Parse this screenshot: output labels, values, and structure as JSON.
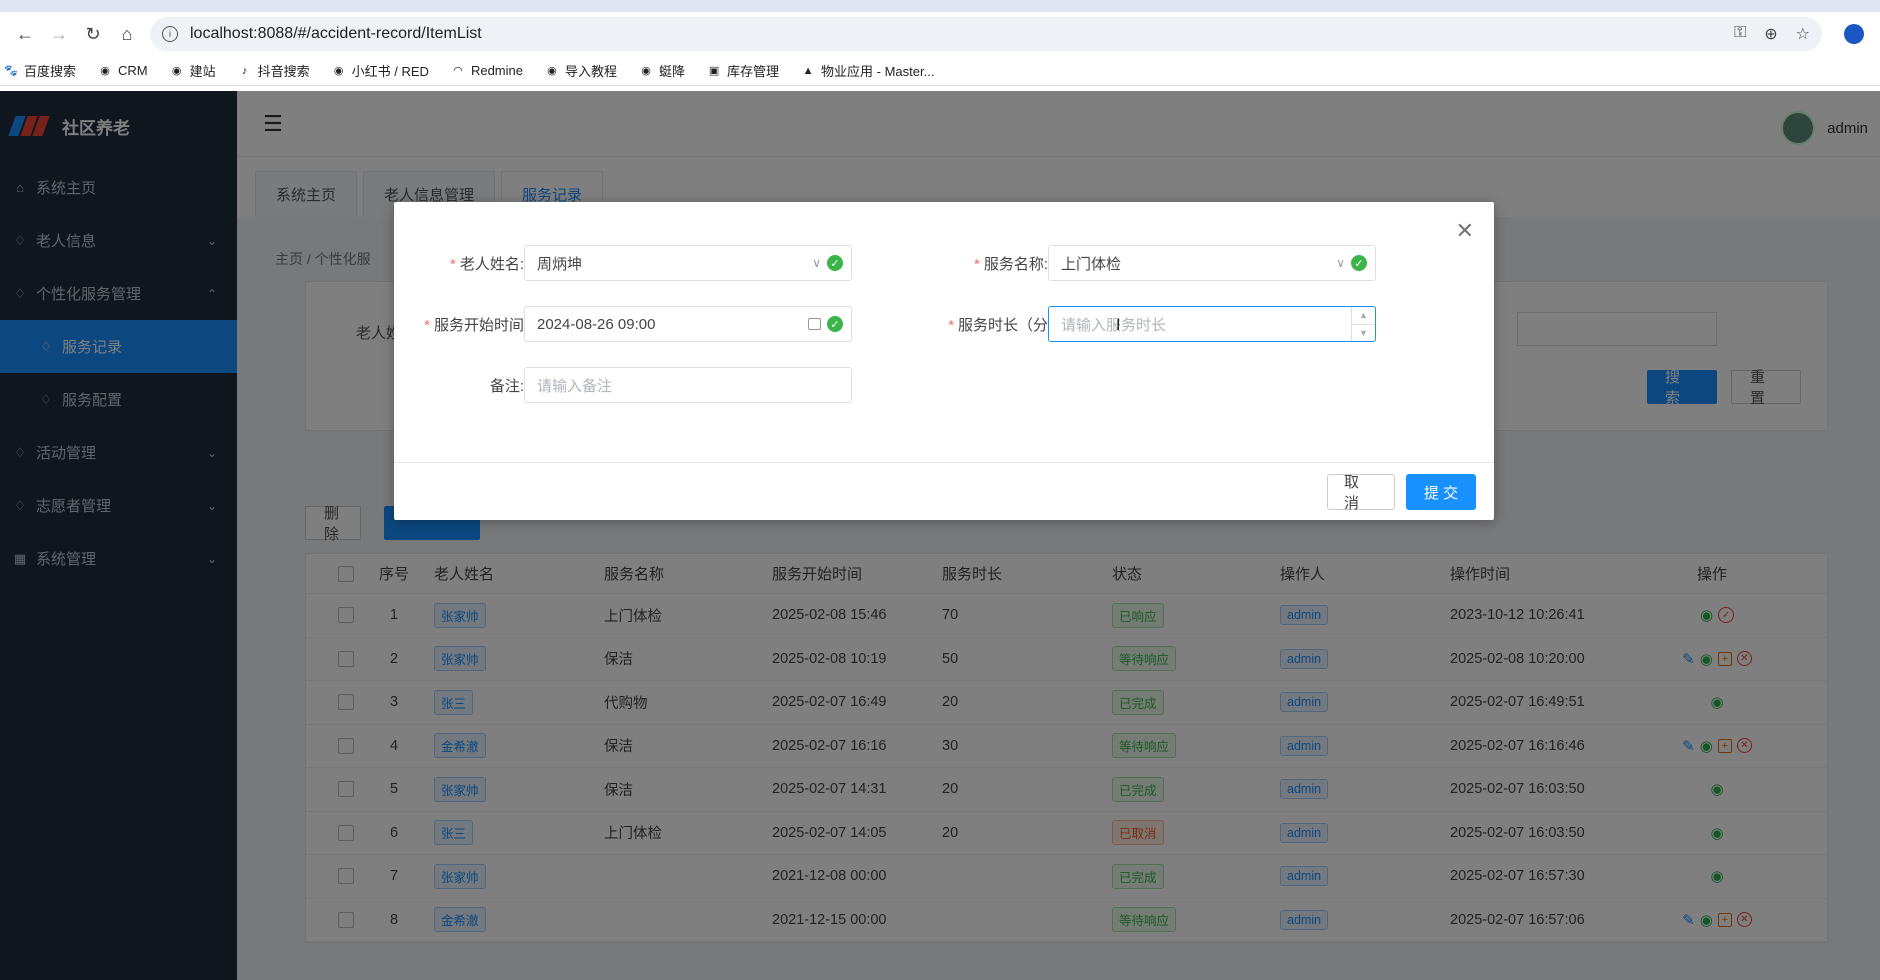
{
  "browser": {
    "url": "localhost:8088/#/accident-record/ItemList",
    "bookmarks": [
      {
        "label": "百度搜索",
        "icon": "paw-icon"
      },
      {
        "label": "CRM",
        "icon": "globe-icon"
      },
      {
        "label": "建站",
        "icon": "globe-icon"
      },
      {
        "label": "抖音搜索",
        "icon": "tiktok-icon"
      },
      {
        "label": "小红书 / RED",
        "icon": "globe-icon"
      },
      {
        "label": "Redmine",
        "icon": "redmine-icon"
      },
      {
        "label": "导入教程",
        "icon": "globe-icon"
      },
      {
        "label": "蜓降",
        "icon": "globe-icon"
      },
      {
        "label": "库存管理",
        "icon": "app-icon"
      },
      {
        "label": "物业应用 - Master...",
        "icon": "mountain-icon"
      }
    ]
  },
  "app": {
    "brand": "社区养老",
    "user": "admin",
    "sidebar": [
      {
        "label": "系统主页",
        "icon": "home-icon",
        "arrow": ""
      },
      {
        "label": "老人信息",
        "icon": "drop-icon",
        "arrow": "⌄"
      },
      {
        "label": "个性化服务管理",
        "icon": "drop-icon",
        "arrow": "⌃"
      },
      {
        "label": "服务记录",
        "icon": "drop-icon",
        "arrow": ""
      },
      {
        "label": "服务配置",
        "icon": "drop-icon",
        "arrow": ""
      },
      {
        "label": "活动管理",
        "icon": "drop-icon",
        "arrow": "⌄"
      },
      {
        "label": "志愿者管理",
        "icon": "drop-icon",
        "arrow": "⌄"
      },
      {
        "label": "系统管理",
        "icon": "grid-icon",
        "arrow": "⌄"
      }
    ],
    "tabs": [
      "系统主页",
      "老人信息管理",
      "服务记录"
    ],
    "breadcrumb": "主页  /  个性化服",
    "search": {
      "label": "老人姓",
      "search_btn": "搜 索",
      "reset_btn": "重 置"
    },
    "actions": {
      "delete_btn": "删 除"
    },
    "table": {
      "headers": [
        "序号",
        "老人姓名",
        "服务名称",
        "服务开始时间",
        "服务时长",
        "状态",
        "操作人",
        "操作时间",
        "操作"
      ],
      "rows": [
        {
          "no": "1",
          "name": "张家帅",
          "service": "上门体检",
          "start": "2025-02-08 15:46",
          "duration": "70",
          "status": "已响应",
          "status_type": "ok",
          "operator": "admin",
          "time": "2023-10-12 10:26:41",
          "ops": [
            "view",
            "check"
          ]
        },
        {
          "no": "2",
          "name": "张家帅",
          "service": "保洁",
          "start": "2025-02-08 10:19",
          "duration": "50",
          "status": "等待响应",
          "status_type": "wait",
          "operator": "admin",
          "time": "2025-02-08 10:20:00",
          "ops": [
            "edit",
            "view",
            "add",
            "cancel"
          ]
        },
        {
          "no": "3",
          "name": "张三",
          "service": "代购物",
          "start": "2025-02-07 16:49",
          "duration": "20",
          "status": "已完成",
          "status_type": "ok",
          "operator": "admin",
          "time": "2025-02-07 16:49:51",
          "ops": [
            "view"
          ]
        },
        {
          "no": "4",
          "name": "金希澈",
          "service": "保洁",
          "start": "2025-02-07 16:16",
          "duration": "30",
          "status": "等待响应",
          "status_type": "wait",
          "operator": "admin",
          "time": "2025-02-07 16:16:46",
          "ops": [
            "edit",
            "view",
            "add",
            "cancel"
          ]
        },
        {
          "no": "5",
          "name": "张家帅",
          "service": "保洁",
          "start": "2025-02-07 14:31",
          "duration": "20",
          "status": "已完成",
          "status_type": "ok",
          "operator": "admin",
          "time": "2025-02-07 16:03:50",
          "ops": [
            "view"
          ]
        },
        {
          "no": "6",
          "name": "张三",
          "service": "上门体检",
          "start": "2025-02-07 14:05",
          "duration": "20",
          "status": "已取消",
          "status_type": "cancel",
          "operator": "admin",
          "time": "2025-02-07 16:03:50",
          "ops": [
            "view"
          ]
        },
        {
          "no": "7",
          "name": "张家帅",
          "service": "",
          "start": "2021-12-08 00:00",
          "duration": "",
          "status": "已完成",
          "status_type": "ok",
          "operator": "admin",
          "time": "2025-02-07 16:57:30",
          "ops": [
            "view"
          ]
        },
        {
          "no": "8",
          "name": "金希澈",
          "service": "",
          "start": "2021-12-15 00:00",
          "duration": "",
          "status": "等待响应",
          "status_type": "wait",
          "operator": "admin",
          "time": "2025-02-07 16:57:06",
          "ops": [
            "edit",
            "view",
            "add",
            "cancel"
          ]
        }
      ]
    }
  },
  "modal": {
    "elder_label": "老人姓名",
    "elder_value": "周炳坤",
    "service_label": "服务名称",
    "service_value": "上门体检",
    "start_label": "服务开始时间",
    "start_value": "2024-08-26 09:00",
    "duration_label": "服务时长（分",
    "duration_placeholder": "请输入服务时长",
    "remark_label": "备注",
    "remark_placeholder": "请输入备注",
    "cancel_btn": "取 消",
    "submit_btn": "提 交",
    "colon": ":"
  }
}
